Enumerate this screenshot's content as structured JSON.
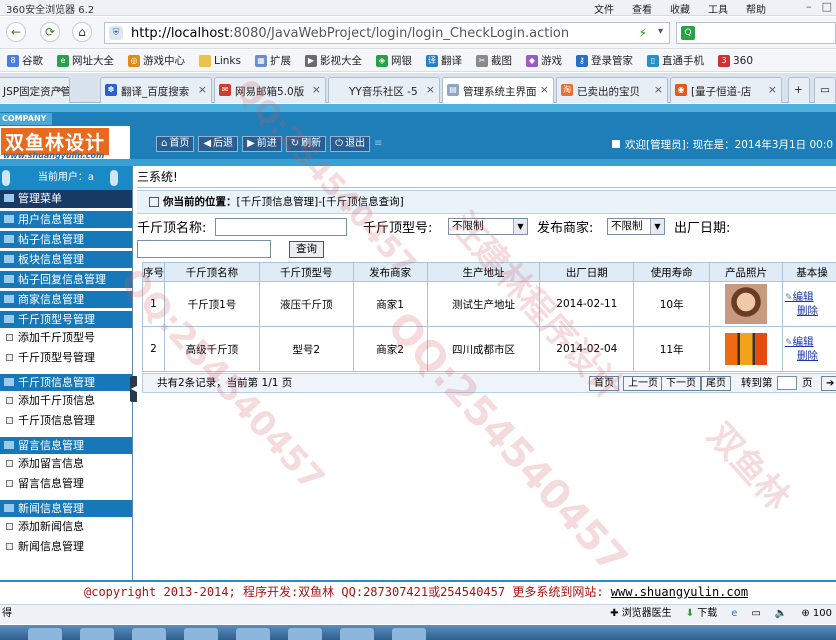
{
  "browser": {
    "title": "360安全浏览器 6.2",
    "menu": [
      "文件",
      "查看",
      "收藏",
      "工具",
      "帮助"
    ],
    "url_host": "http://localhost",
    "url_rest": ":8080/JavaWebProject/login/login_CheckLogin.action",
    "favorites": [
      "谷歌",
      "网址大全",
      "游戏中心",
      "Links",
      "扩展",
      "影视大全",
      "网银",
      "翻译",
      "截图",
      "游戏",
      "登录管家",
      "直通手机",
      "360"
    ],
    "tabs": [
      "JSP固定资产管",
      "翻译_百度搜索",
      "网易邮箱5.0版",
      "YY音乐社区 -5",
      "管理系统主界面",
      "已卖出的宝贝",
      "[量子恒道-店"
    ],
    "status_left": "得",
    "status_items": [
      "浏览器医生",
      "下载",
      "100"
    ]
  },
  "header": {
    "company": "COMPANY",
    "logo_title": "双鱼林设计",
    "logo_url": "www.shuangyulin.com",
    "buttons": [
      "首页",
      "后退",
      "前进",
      "刷新",
      "退出"
    ],
    "welcome": "欢迎[管理员]:   现在是：2014年3月1日  00:0"
  },
  "sidebar": {
    "current_user": "当前用户：a",
    "menu_title": "管理菜单",
    "groups": [
      {
        "label": "用户信息管理",
        "items": []
      },
      {
        "label": "帖子信息管理",
        "items": []
      },
      {
        "label": "板块信息管理",
        "items": []
      },
      {
        "label": "帖子回复信息管理",
        "items": []
      },
      {
        "label": "商家信息管理",
        "items": []
      },
      {
        "label": "千斤顶型号管理",
        "items": [
          "添加千斤顶型号",
          "千斤顶型号管理"
        ]
      },
      {
        "label": "千斤顶信息管理",
        "items": [
          "添加千斤顶信息",
          "千斤顶信息管理"
        ]
      },
      {
        "label": "留言信息管理",
        "items": [
          "添加留言信息",
          "留言信息管理"
        ]
      },
      {
        "label": "新闻信息管理",
        "items": [
          "添加新闻信息",
          "新闻信息管理"
        ]
      }
    ]
  },
  "main": {
    "system_title": "三系统!",
    "location_label": "你当前的位置：",
    "location_path": "[千斤顶信息管理]-[千斤顶信息查询]",
    "search": {
      "name_label": "千斤顶名称:",
      "name_value": "",
      "type_label": "千斤顶型号:",
      "type_value": "不限制",
      "merchant_label": "发布商家:",
      "merchant_value": "不限制",
      "date_label": "出厂日期:",
      "date_value": "",
      "query_button": "查询"
    },
    "table": {
      "headers": [
        "序号",
        "千斤顶名称",
        "千斤顶型号",
        "发布商家",
        "生产地址",
        "出厂日期",
        "使用寿命",
        "产品照片",
        "基本操"
      ],
      "rows": [
        {
          "no": "1",
          "name": "千斤顶1号",
          "type": "液压千斤顶",
          "merchant": "商家1",
          "address": "测试生产地址",
          "date": "2014-02-11",
          "life": "10年",
          "photo": "photo-woman",
          "edit": "编辑",
          "delete": "删除"
        },
        {
          "no": "2",
          "name": "高级千斤顶",
          "type": "型号2",
          "merchant": "商家2",
          "address": "四川成都市区",
          "date": "2014-02-04",
          "life": "11年",
          "photo": "photo-jack",
          "edit": "编辑",
          "delete": "删除"
        }
      ]
    },
    "pager": {
      "summary": "共有2条记录，当前第 1/1 页",
      "buttons": [
        "首页",
        "上一页",
        "下一页",
        "尾页"
      ],
      "goto_label": "转到第",
      "page_unit": "页",
      "go": "➔"
    }
  },
  "footer": {
    "text": "@copyright 2013-2014; 程序开发:双鱼林  QQ:287307421或254540457  更多系统到网站: ",
    "link": "www.shuangyulin.com"
  },
  "colors": {
    "header_blue": "#1e7fb8",
    "sidebar_group": "#1678b8",
    "footer_red": "#b01010"
  }
}
